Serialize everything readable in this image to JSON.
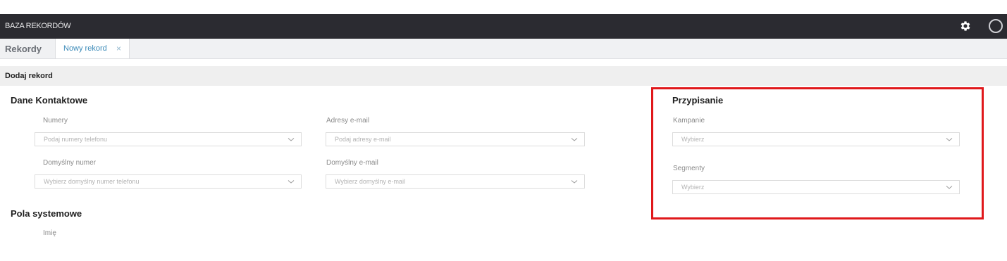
{
  "header": {
    "brand": "BAZA REKORDÓW",
    "settings_icon": "gear-icon",
    "profile_icon": "circle-icon"
  },
  "tabs": {
    "title": "Rekordy",
    "active_tab": {
      "label": "Nowy rekord",
      "close": "×"
    }
  },
  "subheader": {
    "title": "Dodaj rekord"
  },
  "contact": {
    "title": "Dane Kontaktowe",
    "numbers": {
      "label": "Numery",
      "placeholder": "Podaj numery telefonu"
    },
    "emails": {
      "label": "Adresy e-mail",
      "placeholder": "Podaj adresy e-mail"
    },
    "default_number": {
      "label": "Domyślny numer",
      "placeholder": "Wybierz domyślny numer telefonu"
    },
    "default_email": {
      "label": "Domyślny e-mail",
      "placeholder": "Wybierz domyślny e-mail"
    }
  },
  "assignment": {
    "title": "Przypisanie",
    "campaigns": {
      "label": "Kampanie",
      "placeholder": "Wybierz"
    },
    "segments": {
      "label": "Segmenty",
      "placeholder": "Wybierz"
    }
  },
  "system": {
    "title": "Pola systemowe",
    "first_field_label": "Imię"
  },
  "colors": {
    "topbar": "#2b2b31",
    "accent": "#3b8ab8",
    "highlight": "#e0181b"
  }
}
